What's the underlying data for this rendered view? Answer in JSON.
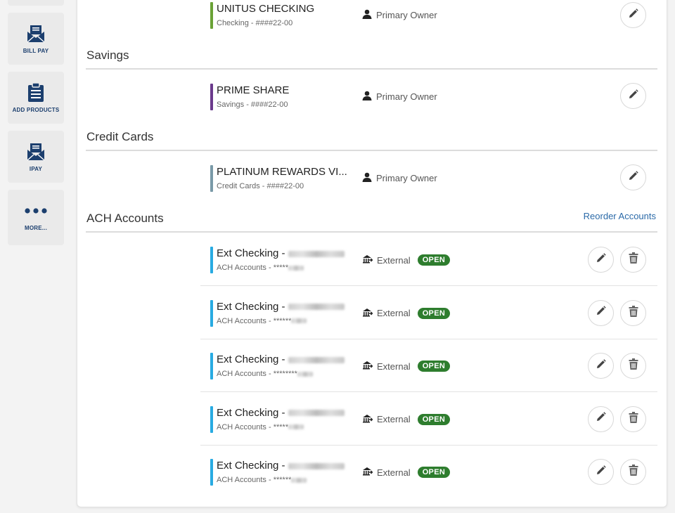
{
  "sidebar": {
    "items": [
      {
        "label": "BILL PAY",
        "icon": "envelope-icon"
      },
      {
        "label": "ADD PRODUCTS",
        "icon": "clipboard-icon"
      },
      {
        "label": "IPAY",
        "icon": "envelope-icon"
      },
      {
        "label": "MORE...",
        "icon": "more-dots-icon"
      }
    ]
  },
  "top_account": {
    "name": "UNITUS CHECKING",
    "sub": "Checking - ####22-00",
    "owner": "Primary Owner",
    "accent": "#6aa236"
  },
  "sections": {
    "savings": {
      "title": "Savings",
      "account": {
        "name": "PRIME SHARE",
        "sub": "Savings - ####22-00",
        "owner": "Primary Owner",
        "accent": "#6b3a8c"
      }
    },
    "credit": {
      "title": "Credit Cards",
      "account": {
        "name": "PLATINUM REWARDS VI...",
        "sub": "Credit Cards - ####22-00",
        "owner": "Primary Owner",
        "accent": "#7a9aa8"
      }
    },
    "ach": {
      "title": "ACH Accounts",
      "reorder_label": "Reorder Accounts",
      "accent": "#29abe2",
      "accounts": [
        {
          "name": "Ext Checking - ",
          "sub": "ACH Accounts - *****",
          "owner": "External",
          "status": "OPEN"
        },
        {
          "name": "Ext Checking - ",
          "sub": "ACH Accounts - ******",
          "owner": "External",
          "status": "OPEN"
        },
        {
          "name": "Ext Checking - ",
          "sub": "ACH Accounts - ********",
          "owner": "External",
          "status": "OPEN"
        },
        {
          "name": "Ext Checking - ",
          "sub": "ACH Accounts - *****",
          "owner": "External",
          "status": "OPEN"
        },
        {
          "name": "Ext Checking - ",
          "sub": "ACH Accounts - ******",
          "owner": "External",
          "status": "OPEN"
        }
      ]
    }
  },
  "colors": {
    "navy": "#1c3f6e",
    "link": "#2b6aa8",
    "open_badge": "#2e7d2e"
  }
}
